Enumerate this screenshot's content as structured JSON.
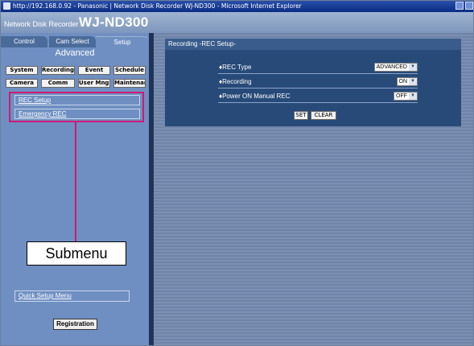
{
  "window": {
    "title": "http://192.168.0.92 - Panasonic | Network Disk Recorder WJ-ND300 - Microsoft Internet Explorer"
  },
  "header": {
    "product_prefix": "Network Disk Recorder",
    "product_name": "WJ-ND300"
  },
  "tabs": [
    {
      "label": "Control"
    },
    {
      "label": "Cam Select"
    },
    {
      "label": "Setup"
    }
  ],
  "left": {
    "section_title": "Advanced",
    "buttons_row1": [
      "System",
      "Recording",
      "Event",
      "Schedule"
    ],
    "buttons_row2": [
      "Camera",
      "Comm",
      "User Mng.",
      "Maintenance"
    ],
    "submenu_items": [
      "REC Setup",
      "Emergency REC"
    ],
    "callout_label": "Submenu",
    "quick_setup": "Quick Setup Menu",
    "registration": "Registration"
  },
  "panel": {
    "title": "Recording -REC Setup-",
    "rows": [
      {
        "label": "♦REC Type",
        "value": "ADVANCED"
      },
      {
        "label": "♦Recording",
        "value": "ON"
      },
      {
        "label": "♦Power ON Manual REC",
        "value": "OFF"
      }
    ],
    "set_label": "SET",
    "clear_label": "CLEAR"
  },
  "colors": {
    "callout": "#cc1a75",
    "left_pane": "#6f8fc2",
    "panel": "#274a79"
  }
}
